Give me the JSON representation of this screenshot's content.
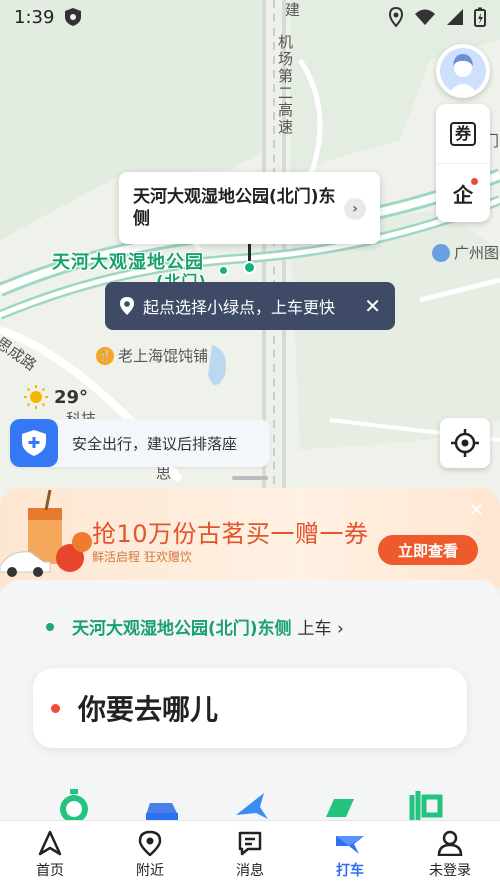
{
  "status_bar": {
    "time": "1:39"
  },
  "map": {
    "road_vertical_label": "机场第二高速",
    "road_vertical_top": "建",
    "park_label_line1": "天河大观湿地公园",
    "park_label_line2": "(北门)",
    "road_left_label": "思成路",
    "restaurant_label": "老上海馄饨铺",
    "poi_right_label": "广州图",
    "partial_bottom_label": "科技",
    "partial_bottom2": "思",
    "partial_top_right": "门"
  },
  "pickup_card": {
    "title": "天河大观湿地公园(北门)东侧"
  },
  "tip_bubble": {
    "text": "起点选择小绿点，上车更快"
  },
  "weather": {
    "temp": "29°"
  },
  "safety": {
    "text": "安全出行，建议后排落座"
  },
  "side_buttons": {
    "coupon": "券",
    "enterprise": "企"
  },
  "banner": {
    "headline": "抢10万份古茗买一赠一券",
    "sub": "鲜活启程   狂欢赠饮",
    "cta": "立即查看",
    "close": "✕"
  },
  "sheet": {
    "pickup_location": "天河大观湿地公园(北门)东侧",
    "pickup_suffix": "上车 ›",
    "destination_placeholder": "你要去哪儿"
  },
  "tabs": [
    {
      "label": "首页",
      "icon": "navigation-arrow-icon",
      "active": false
    },
    {
      "label": "附近",
      "icon": "location-pin-icon",
      "active": false
    },
    {
      "label": "消息",
      "icon": "message-icon",
      "active": false
    },
    {
      "label": "打车",
      "icon": "taxi-icon",
      "active": true
    },
    {
      "label": "未登录",
      "icon": "user-icon",
      "active": false
    }
  ],
  "colors": {
    "accent": "#2f6ff1",
    "green": "#17a26d",
    "banner_orange": "#ef5a2d"
  }
}
